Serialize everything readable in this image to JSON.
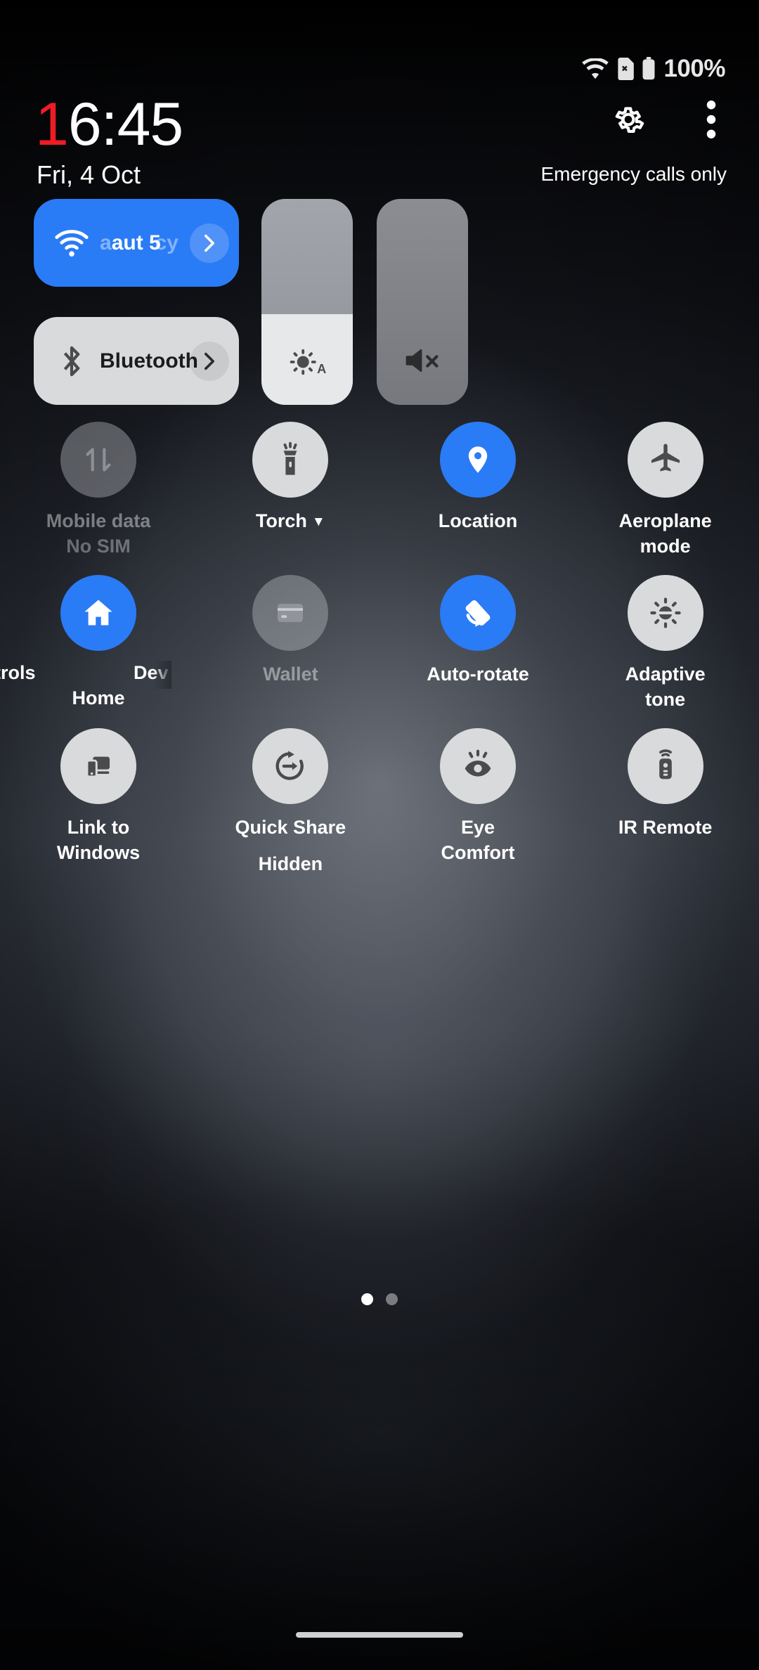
{
  "status_bar": {
    "wifi_icon": "wifi-icon",
    "sim_icon": "sim-card-x-icon",
    "battery_icon": "battery-full-icon",
    "battery_text": "100%"
  },
  "header": {
    "time_highlight": "1",
    "time_rest": "6:45",
    "date": "Fri, 4 Oct",
    "settings_icon": "gear-icon",
    "overflow_icon": "more-vertical-icon",
    "carrier_status": "Emergency calls only"
  },
  "connectivity_tiles": [
    {
      "name": "wifi",
      "label": "aut 5",
      "ghost_label": "cy",
      "icon": "wifi-icon",
      "state": "on",
      "accent": "#2a7bf6",
      "expand_icon": "chevron-right-icon"
    },
    {
      "name": "bluetooth",
      "label": "Bluetooth",
      "icon": "bluetooth-icon",
      "state": "off",
      "accent": "#d9dadc",
      "expand_icon": "chevron-right-icon"
    }
  ],
  "sliders": [
    {
      "name": "brightness",
      "icon": "brightness-auto-icon",
      "value": 44,
      "state": "partial"
    },
    {
      "name": "volume",
      "icon": "volume-mute-icon",
      "value": 0,
      "state": "muted"
    }
  ],
  "toggles": [
    {
      "name": "mobile-data",
      "label": "Mobile data",
      "sublabel": "No SIM",
      "icon": "data-transfer-icon",
      "state": "disabled"
    },
    {
      "name": "torch",
      "label": "Torch",
      "has_dropdown": true,
      "icon": "flashlight-icon",
      "state": "off"
    },
    {
      "name": "location",
      "label": "Location",
      "icon": "location-pin-icon",
      "state": "on"
    },
    {
      "name": "aeroplane-mode",
      "label": "Aeroplane\nmode",
      "icon": "airplane-icon",
      "state": "off"
    },
    {
      "name": "home",
      "label": "Home",
      "fragment_left": "trols",
      "fragment_right": "Dev",
      "icon": "home-icon",
      "state": "on"
    },
    {
      "name": "wallet",
      "label": "Wallet",
      "icon": "wallet-card-icon",
      "state": "disabled"
    },
    {
      "name": "auto-rotate",
      "label": "Auto-rotate",
      "icon": "auto-rotate-icon",
      "state": "on"
    },
    {
      "name": "adaptive-tone",
      "label": "Adaptive\ntone",
      "icon": "adaptive-tone-icon",
      "state": "off"
    },
    {
      "name": "link-to-windows",
      "label": "Link to\nWindows",
      "icon": "link-to-windows-icon",
      "state": "off"
    },
    {
      "name": "quick-share",
      "label": "Quick Share",
      "sublabel": "Hidden",
      "icon": "quick-share-icon",
      "state": "off"
    },
    {
      "name": "eye-comfort",
      "label": "Eye\nComfort",
      "icon": "eye-comfort-icon",
      "state": "off"
    },
    {
      "name": "ir-remote",
      "label": "IR Remote",
      "icon": "remote-control-icon",
      "state": "off"
    }
  ],
  "pagination": {
    "total": 2,
    "current": 1
  },
  "colors": {
    "accent_on": "#2a7bf6",
    "tile_off": "#d9dadc",
    "time_highlight": "#ee1c25"
  }
}
